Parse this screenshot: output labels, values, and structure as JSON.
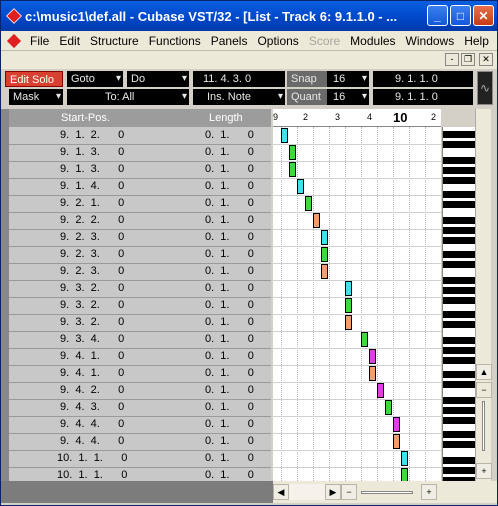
{
  "window": {
    "title": "c:\\music1\\def.all - Cubase VST/32 - [List - Track 6:  9.1.1.0 - ...",
    "minimize_label": "_",
    "maximize_label": "□",
    "close_label": "✕"
  },
  "menubar": {
    "items": [
      "File",
      "Edit",
      "Structure",
      "Functions",
      "Panels",
      "Options",
      "Score",
      "Modules",
      "Windows",
      "Help"
    ],
    "disabled": [
      "Score"
    ],
    "mdi_minimize": "-",
    "mdi_restore": "❐",
    "mdi_close": "✕"
  },
  "toolbar": {
    "edit_solo": "Edit Solo",
    "goto": "Goto",
    "do": "Do",
    "position": "11.  4.  3.      0",
    "snap_label": "Snap",
    "snap_value": "16",
    "snap_pos": "9.  1.  1.      0",
    "mask": "Mask",
    "to_all": "To: All",
    "ins_note": "Ins. Note",
    "quant_label": "Quant",
    "quant_value": "16",
    "quant_pos": "9.  1.  1.      0",
    "dropdown_arrow": "▾",
    "wave_icon": "∿"
  },
  "columns": {
    "start_pos": "Start-Pos.",
    "length": "Length"
  },
  "ruler": {
    "labels": [
      "9",
      "2",
      "3",
      "4",
      "10",
      "2"
    ]
  },
  "rows": [
    {
      "start": " 9.  1.  2.      0",
      "length": "0.  1.      0"
    },
    {
      "start": " 9.  1.  3.      0",
      "length": "0.  1.      0"
    },
    {
      "start": " 9.  1.  3.      0",
      "length": "0.  1.      0"
    },
    {
      "start": " 9.  1.  4.      0",
      "length": "0.  1.      0"
    },
    {
      "start": " 9.  2.  1.      0",
      "length": "0.  1.      0"
    },
    {
      "start": " 9.  2.  2.      0",
      "length": "0.  1.      0"
    },
    {
      "start": " 9.  2.  3.      0",
      "length": "0.  1.      0"
    },
    {
      "start": " 9.  2.  3.      0",
      "length": "0.  1.      0"
    },
    {
      "start": " 9.  2.  3.      0",
      "length": "0.  1.      0"
    },
    {
      "start": " 9.  3.  2.      0",
      "length": "0.  1.      0"
    },
    {
      "start": " 9.  3.  2.      0",
      "length": "0.  1.      0"
    },
    {
      "start": " 9.  3.  2.      0",
      "length": "0.  1.      0"
    },
    {
      "start": " 9.  3.  4.      0",
      "length": "0.  1.      0"
    },
    {
      "start": " 9.  4.  1.      0",
      "length": "0.  1.      0"
    },
    {
      "start": " 9.  4.  1.      0",
      "length": "0.  1.      0"
    },
    {
      "start": " 9.  4.  2.      0",
      "length": "0.  1.      0"
    },
    {
      "start": " 9.  4.  3.      0",
      "length": "0.  1.      0"
    },
    {
      "start": " 9.  4.  4.      0",
      "length": "0.  1.      0"
    },
    {
      "start": " 9.  4.  4.      0",
      "length": "0.  1.      0"
    },
    {
      "start": "10.  1.  1.      0",
      "length": "0.  1.      0"
    },
    {
      "start": "10.  1.  1.      0",
      "length": "0.  1.      0"
    }
  ],
  "note_colors": {
    "cyan": "#40e0f0",
    "green": "#40d840",
    "orange": "#f0a070",
    "magenta": "#e040e0"
  },
  "scrollbar": {
    "up": "▲",
    "down": "▼",
    "left": "◀",
    "right": "▶",
    "minus": "−",
    "plus": "+"
  }
}
